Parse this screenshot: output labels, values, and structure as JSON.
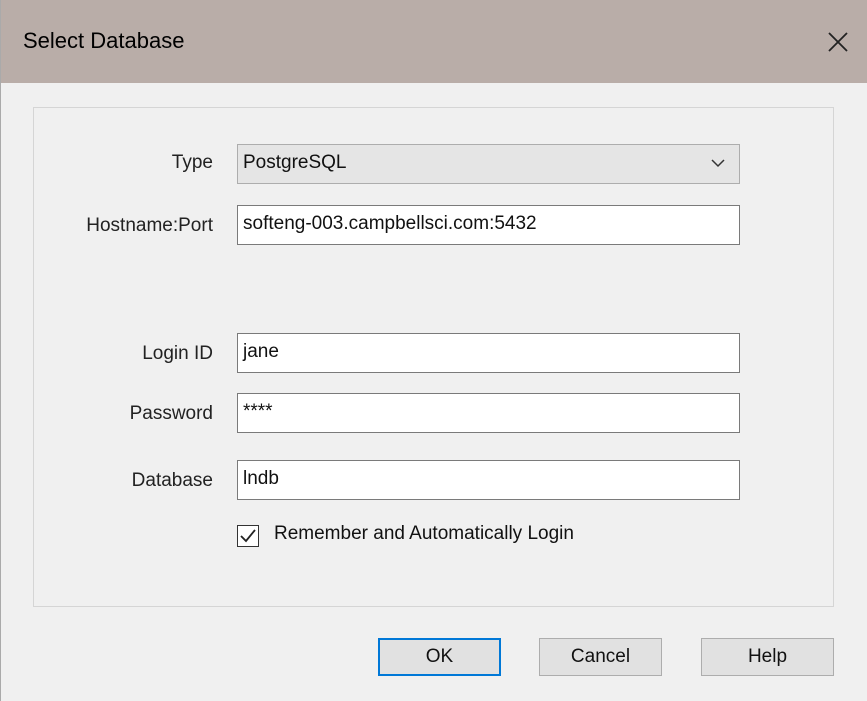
{
  "window": {
    "title": "Select Database"
  },
  "form": {
    "type_label": "Type",
    "type_value": "PostgreSQL",
    "host_label": "Hostname:Port",
    "host_value": "softeng-003.campbellsci.com:5432",
    "login_label": "Login ID",
    "login_value": "jane",
    "password_label": "Password",
    "password_value": "****",
    "database_label": "Database",
    "database_value": "lndb",
    "remember_label": "Remember and Automatically Login",
    "remember_checked": true
  },
  "buttons": {
    "ok": "OK",
    "cancel": "Cancel",
    "help": "Help"
  },
  "icons": {
    "close": "close-icon",
    "dropdown": "chevron-down-icon",
    "check": "checkmark-icon"
  },
  "colors": {
    "titlebar": "#b9ada8",
    "accent": "#0078d7",
    "dialog_bg": "#f0f0f0"
  }
}
